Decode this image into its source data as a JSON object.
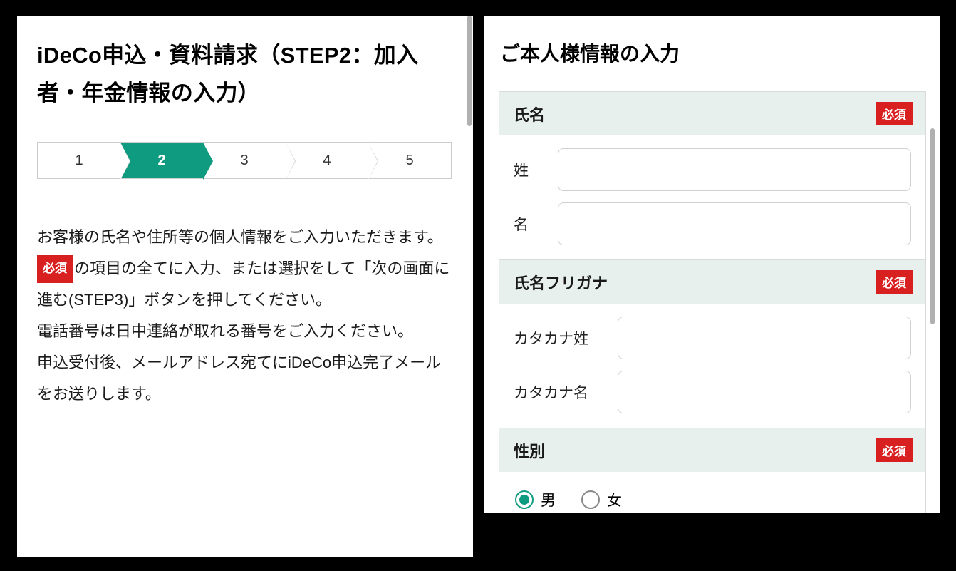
{
  "left": {
    "title": "iDeCo申込・資料請求（STEP2：加入者・年金情報の入力）",
    "steps": [
      "1",
      "2",
      "3",
      "4",
      "5"
    ],
    "active_step_index": 1,
    "desc_line1": "お客様の氏名や住所等の個人情報をご入力いただきます。",
    "required_badge": "必須",
    "desc_line2a": "の項目の全てに入力、または選択をして「次の画面に進む(STEP3)」ボタンを押してください。",
    "desc_line3": "電話番号は日中連絡が取れる番号をご入力ください。",
    "desc_line4": "申込受付後、メールアドレス宛てにiDeCo申込完了メールをお送りします。"
  },
  "right": {
    "section_title": "ご本人様情報の入力",
    "required_badge": "必須",
    "name": {
      "header": "氏名",
      "sei_label": "姓",
      "mei_label": "名"
    },
    "kana": {
      "header": "氏名フリガナ",
      "sei_label": "カタカナ姓",
      "mei_label": "カタカナ名"
    },
    "gender": {
      "header": "性別",
      "male": "男",
      "female": "女",
      "selected": "male"
    }
  }
}
